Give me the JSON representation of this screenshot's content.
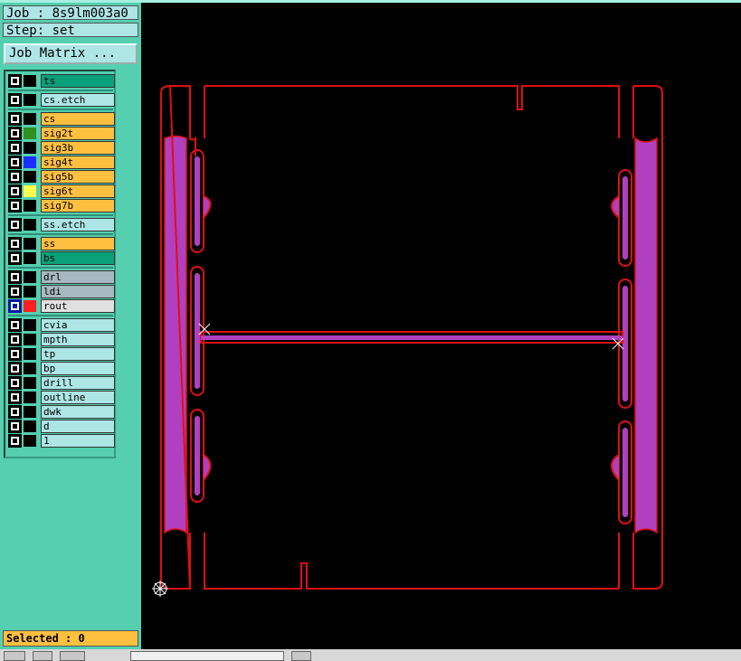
{
  "header": {
    "job": "Job : 8s9lm003a0",
    "step": "Step: set",
    "job_matrix_button": "Job Matrix ..."
  },
  "layers": [
    {
      "name": "ts",
      "color": "#0aa07a",
      "swatch": "#000000"
    },
    {
      "name": "cs.etch",
      "color": "#aee6e6",
      "swatch": "#000000"
    },
    {
      "name": "cs",
      "color": "#ffc040",
      "swatch": "#000000"
    },
    {
      "name": "sig2t",
      "color": "#ffc040",
      "swatch": "#2f8f1f"
    },
    {
      "name": "sig3b",
      "color": "#ffc040",
      "swatch": "#000000"
    },
    {
      "name": "sig4t",
      "color": "#ffc040",
      "swatch": "#1a2fff"
    },
    {
      "name": "sig5b",
      "color": "#ffc040",
      "swatch": "#000000"
    },
    {
      "name": "sig6t",
      "color": "#ffc040",
      "swatch": "#ffff50"
    },
    {
      "name": "sig7b",
      "color": "#ffc040",
      "swatch": "#000000"
    },
    {
      "name": "ss.etch",
      "color": "#aee6e6",
      "swatch": "#000000"
    },
    {
      "name": "ss",
      "color": "#ffc040",
      "swatch": "#000000"
    },
    {
      "name": "bs",
      "color": "#0aa07a",
      "swatch": "#000000"
    },
    {
      "name": "drl",
      "color": "#a8b8c0",
      "swatch": "#000000"
    },
    {
      "name": "ldi",
      "color": "#a8b8c0",
      "swatch": "#000000"
    },
    {
      "name": "rout",
      "color": "#e0e0e0",
      "swatch": "#ff2020",
      "active": true
    },
    {
      "name": "cvia",
      "color": "#aee6e6",
      "swatch": "#000000"
    },
    {
      "name": "mpth",
      "color": "#aee6e6",
      "swatch": "#000000"
    },
    {
      "name": "tp",
      "color": "#aee6e6",
      "swatch": "#000000"
    },
    {
      "name": "bp",
      "color": "#aee6e6",
      "swatch": "#000000"
    },
    {
      "name": "drill",
      "color": "#aee6e6",
      "swatch": "#000000"
    },
    {
      "name": "outline",
      "color": "#aee6e6",
      "swatch": "#000000"
    },
    {
      "name": "dwk",
      "color": "#aee6e6",
      "swatch": "#000000"
    },
    {
      "name": "d",
      "color": "#aee6e6",
      "swatch": "#000000"
    },
    {
      "name": "1",
      "color": "#aee6e6",
      "swatch": "#000000"
    }
  ],
  "status": {
    "selected": "Selected : 0"
  },
  "colors": {
    "outline": "#e01010",
    "fill": "#b040c0",
    "canvas": "#000000"
  }
}
